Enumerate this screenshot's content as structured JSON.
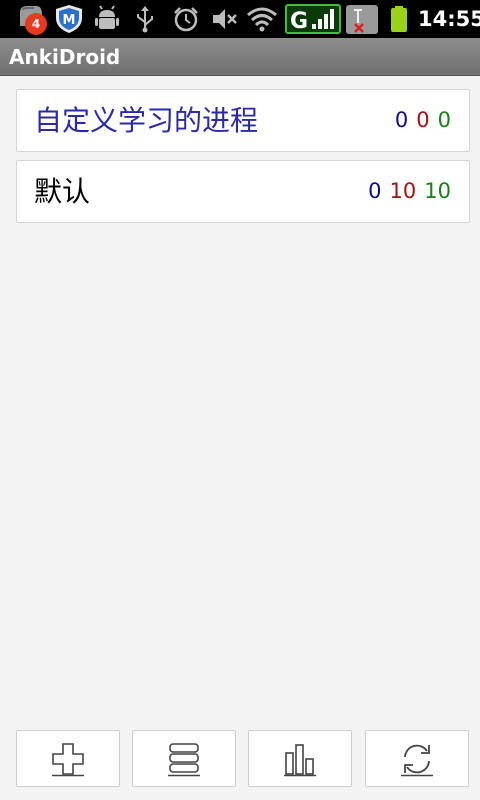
{
  "status_bar": {
    "notification_count": "4",
    "time": "14:55",
    "network_letter": "G",
    "icons": [
      "notification-icon",
      "shield-app-icon",
      "android-debug-icon",
      "usb-icon",
      "alarm-icon",
      "mute-icon",
      "wifi-icon",
      "signal-icon",
      "no-sim-icon",
      "battery-icon"
    ]
  },
  "app": {
    "title": "AnkiDroid"
  },
  "decks": [
    {
      "name": "自定义学习的进程",
      "new": "0",
      "learn": "0",
      "due": "0",
      "name_color": "#2a2aa8"
    },
    {
      "name": "默认",
      "new": "0",
      "learn": "10",
      "due": "10",
      "name_color": "#000000"
    }
  ],
  "toolbar": {
    "buttons": [
      "add-icon",
      "decks-icon",
      "statistics-icon",
      "sync-icon"
    ]
  },
  "colors": {
    "new": "#0d0d8c",
    "learn": "#a01414",
    "due": "#168016",
    "title_bar": "#7d7d7d"
  }
}
